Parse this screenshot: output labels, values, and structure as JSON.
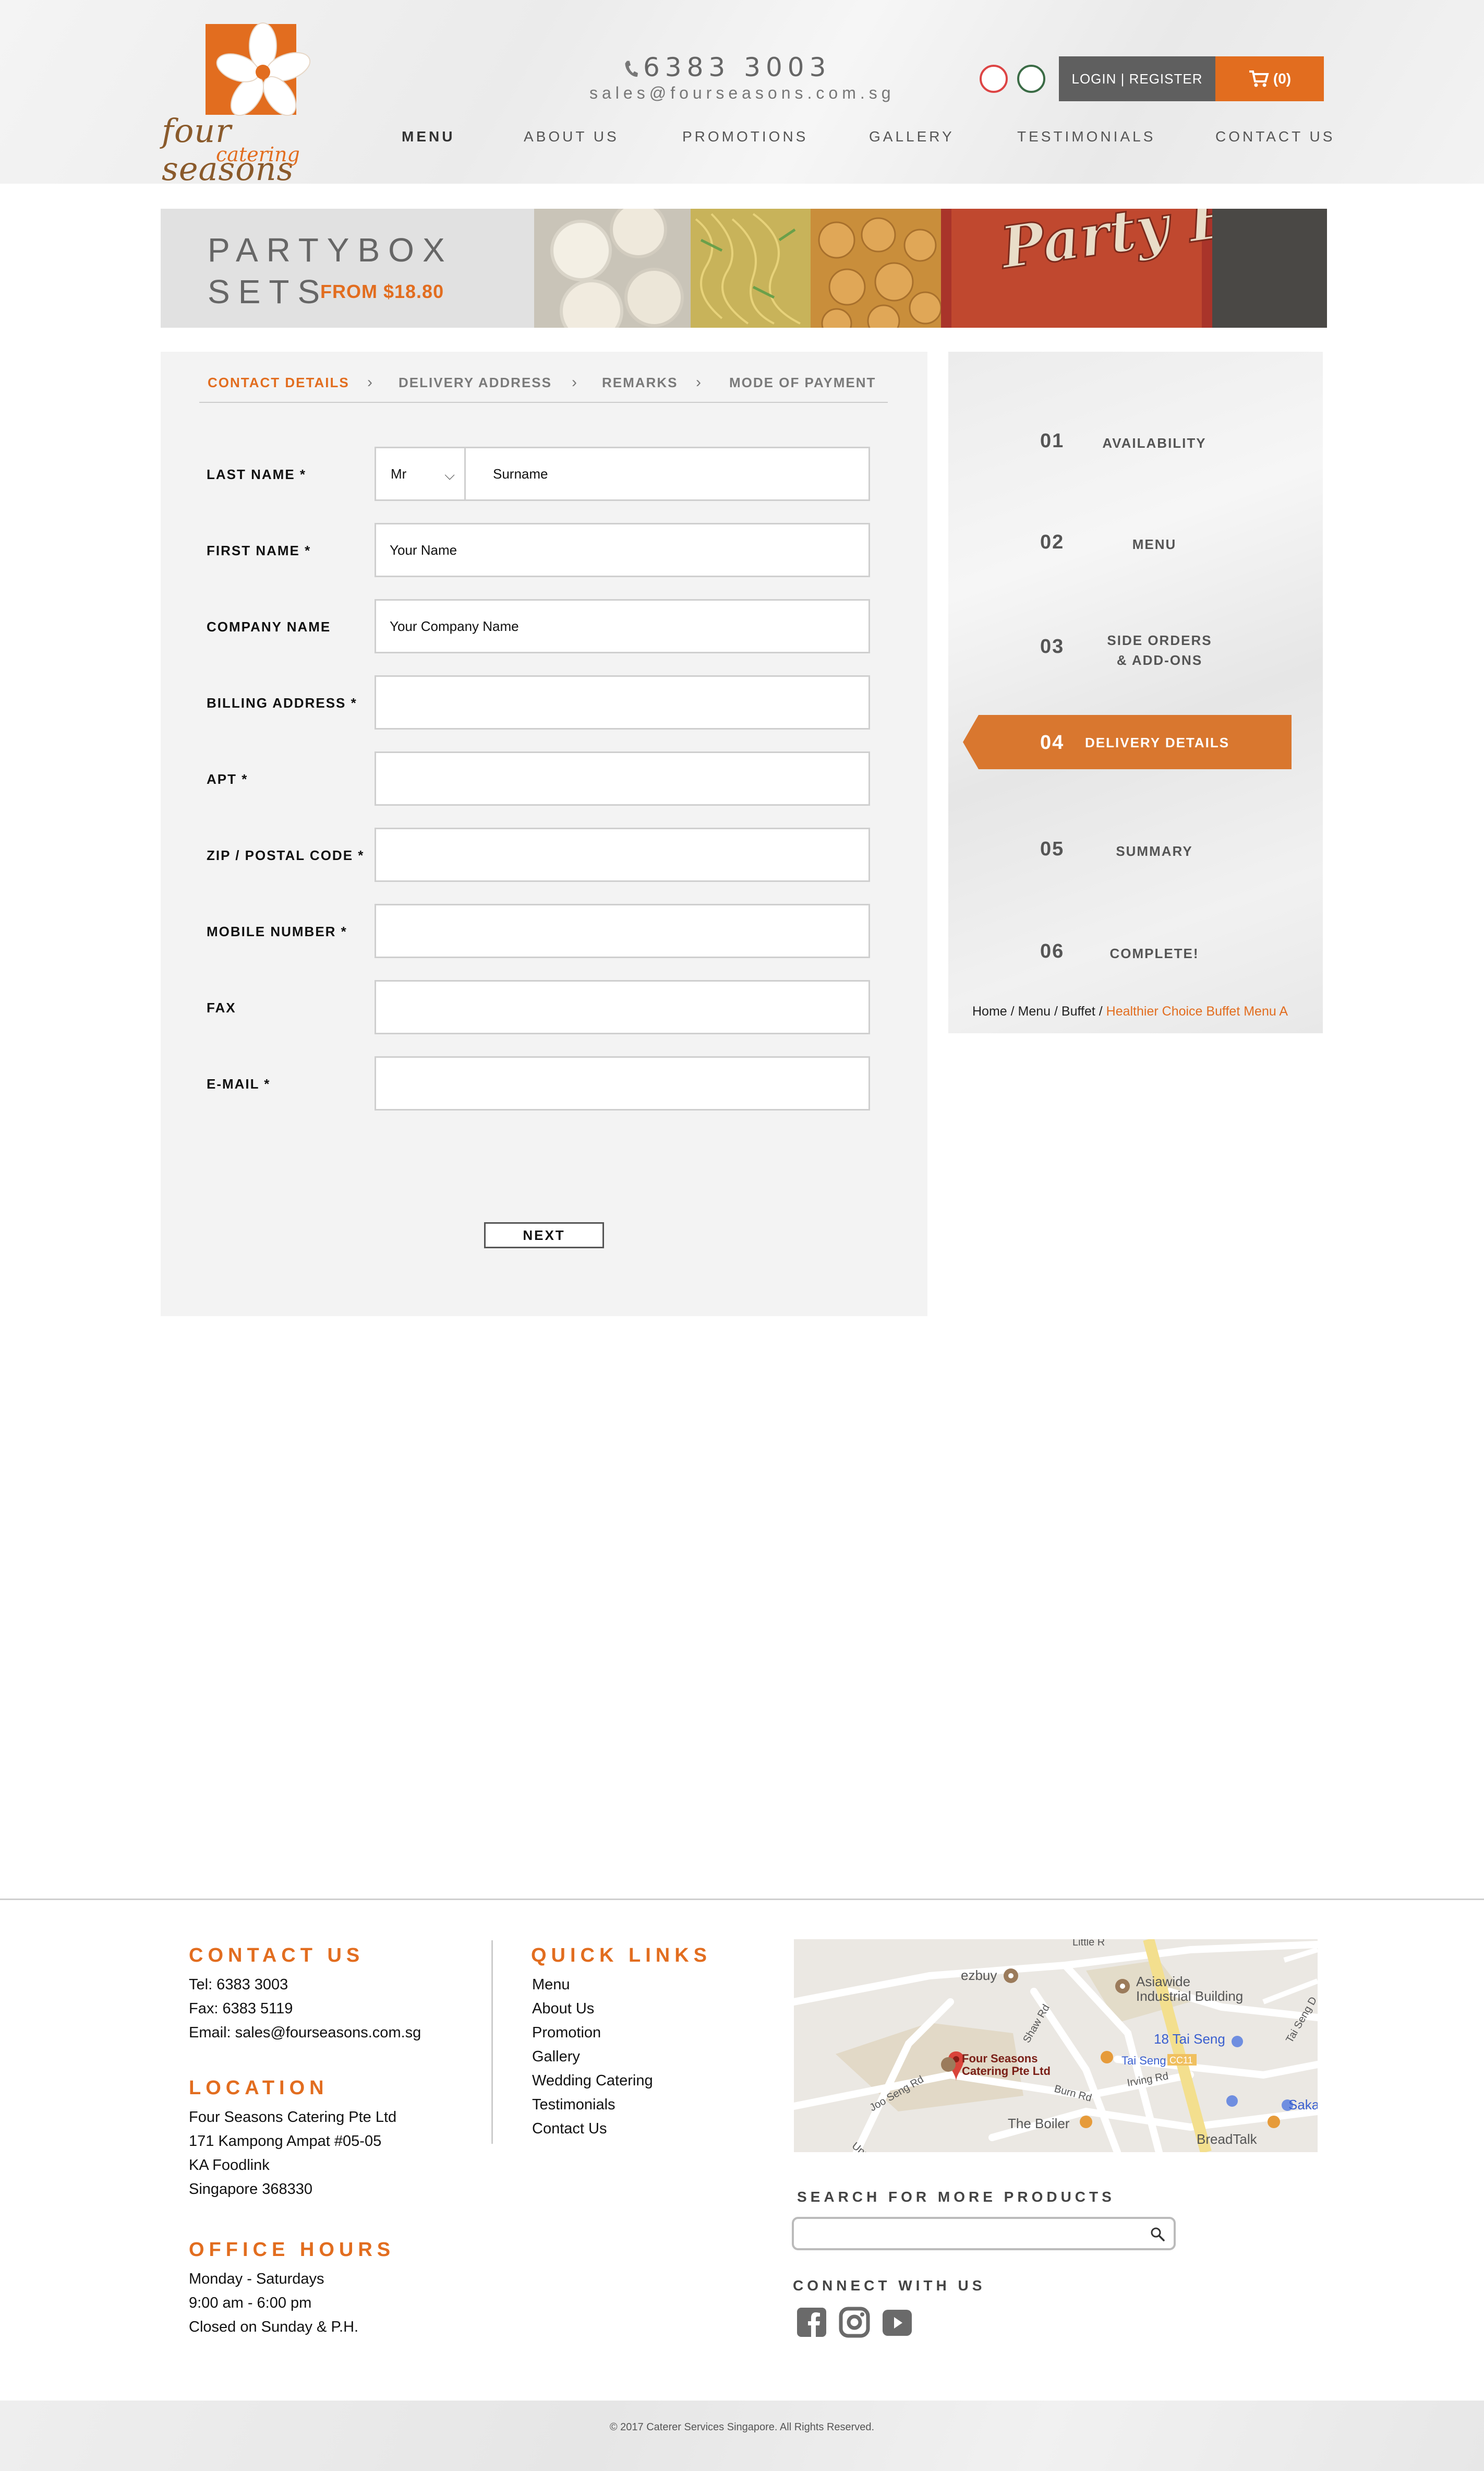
{
  "header": {
    "brand_name": "four seasons",
    "brand_sub": "catering",
    "phone": "6383 3003",
    "email": "sales@fourseasons.com.sg",
    "login_label": "LOGIN | REGISTER",
    "cart_label": "(0)",
    "nav": [
      "MENU",
      "ABOUT US",
      "PROMOTIONS",
      "GALLERY",
      "TESTIMONIALS",
      "CONTACT US"
    ]
  },
  "banner": {
    "line1": "PARTYBOX",
    "line2": "SETS",
    "price": "FROM $18.80",
    "photo_text": "Party Box"
  },
  "form": {
    "tabs": [
      "CONTACT DETAILS",
      "DELIVERY ADDRESS",
      "REMARKS",
      "MODE OF PAYMENT"
    ],
    "fields": {
      "last_name": {
        "label": "LAST NAME *",
        "title_value": "Mr",
        "placeholder": "Surname"
      },
      "first_name": {
        "label": "FIRST NAME *",
        "placeholder": "Your Name"
      },
      "company": {
        "label": "COMPANY NAME",
        "placeholder": "Your Company Name"
      },
      "billing": {
        "label": "BILLING ADDRESS *",
        "placeholder": ""
      },
      "apt": {
        "label": "APT *",
        "placeholder": ""
      },
      "zip": {
        "label": "ZIP / POSTAL CODE *",
        "placeholder": ""
      },
      "mobile": {
        "label": "MOBILE NUMBER *",
        "placeholder": ""
      },
      "fax": {
        "label": "FAX",
        "placeholder": ""
      },
      "email": {
        "label": "E-MAIL *",
        "placeholder": ""
      }
    },
    "next_label": "NEXT"
  },
  "steps": [
    {
      "num": "01",
      "label": "AVAILABILITY"
    },
    {
      "num": "02",
      "label": "MENU"
    },
    {
      "num": "03",
      "label": "SIDE ORDERS & ADD-ONS"
    },
    {
      "num": "04",
      "label": "DELIVERY DETAILS"
    },
    {
      "num": "05",
      "label": "SUMMARY"
    },
    {
      "num": "06",
      "label": "COMPLETE!"
    }
  ],
  "breadcrumb": {
    "home": "Home",
    "sep": " / ",
    "menu": "Menu",
    "buffet": "Buffet",
    "current": "Healthier Choice Buffet Menu A"
  },
  "footer": {
    "contact_heading": "CONTACT US",
    "tel": "Tel: 6383 3003",
    "fax": "Fax: 6383 5119",
    "email": "Email: sales@fourseasons.com.sg",
    "location_heading": "LOCATION",
    "address": [
      "Four Seasons Catering Pte Ltd",
      "171 Kampong Ampat #05-05",
      "KA Foodlink",
      "Singapore 368330"
    ],
    "hours_heading": "OFFICE HOURS",
    "hours": [
      "Monday - Saturdays",
      "9:00 am - 6:00 pm",
      "Closed on Sunday & P.H."
    ],
    "links_heading": "QUICK LINKS",
    "links": [
      "Menu",
      "About Us",
      "Promotion",
      "Gallery",
      "Wedding Catering",
      "Testimonials",
      "Contact Us"
    ],
    "map_labels": {
      "ezbuy": "ezbuy",
      "asiawide_1": "Asiawide",
      "asiawide_2": "Industrial Building",
      "pin_1": "Four Seasons",
      "pin_2": "Catering Pte Ltd",
      "tai_seng_18": "18 Tai Seng",
      "tai_seng": "Tai Seng",
      "cc11": "CC11",
      "boiler": "The Boiler",
      "breadtalk": "BreadTalk",
      "saka": "Saka",
      "joo_seng": "Joo Seng Rd",
      "upper_aljunied": "Upper Aljunied Rd",
      "shaw": "Shaw Rd",
      "burn": "Burn Rd",
      "irving": "Irving Rd",
      "little": "Little R",
      "tai_seng_st": "Tai Seng D"
    },
    "search_heading": "SEARCH FOR MORE PRODUCTS",
    "search_placeholder": "",
    "connect_heading": "CONNECT WITH US",
    "copyright": "© 2017 Caterer Services Singapore. All Rights Reserved."
  },
  "colors": {
    "accent": "#e26d1f",
    "active_step": "#d9772f",
    "login_bg": "#5f5f5f"
  },
  "icons": [
    "phone-icon",
    "cart-icon",
    "chevron-down-icon",
    "chevron-right-icon",
    "search-icon",
    "facebook-icon",
    "instagram-icon",
    "youtube-icon",
    "map-pin-icon"
  ]
}
